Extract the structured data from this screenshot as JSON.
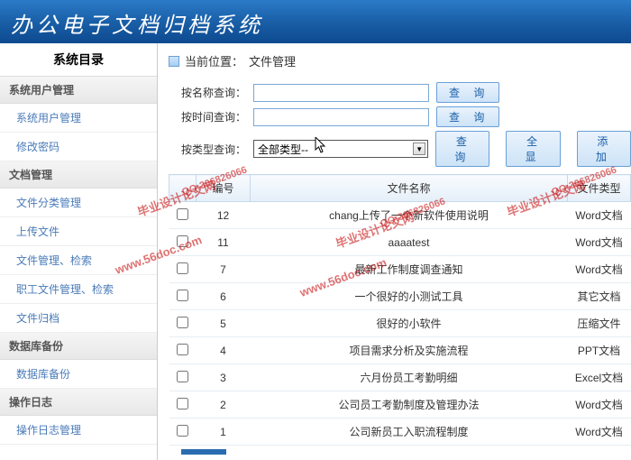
{
  "header": {
    "title": "办公电子文档归档系统"
  },
  "sidebar": {
    "title": "系统目录",
    "groups": [
      {
        "label": "系统用户管理",
        "items": [
          "系统用户管理",
          "修改密码"
        ]
      },
      {
        "label": "文档管理",
        "items": [
          "文件分类管理",
          "上传文件",
          "文件管理、检索",
          "职工文件管理、检索",
          "文件归档"
        ]
      },
      {
        "label": "数据库备份",
        "items": [
          "数据库备份"
        ]
      },
      {
        "label": "操作日志",
        "items": [
          "操作日志管理"
        ]
      }
    ]
  },
  "breadcrumb": {
    "prefix": "当前位置：",
    "current": "文件管理"
  },
  "search": {
    "byName": {
      "label": "按名称查询：",
      "btn": "查 询"
    },
    "byTime": {
      "label": "按时间查询：",
      "btn": "查 询"
    },
    "byType": {
      "label": "按类型查询：",
      "selected": "全部类型--",
      "btn": "查 询",
      "showAll": "全 显",
      "add": "添 加"
    }
  },
  "table": {
    "headers": [
      "",
      "编号",
      "文件名称",
      "文件类型"
    ],
    "rows": [
      {
        "id": "12",
        "name": "chang上传了一个新软件使用说明",
        "type": "Word文档"
      },
      {
        "id": "11",
        "name": "aaaatest",
        "type": "Word文档"
      },
      {
        "id": "7",
        "name": "最新工作制度调查通知",
        "type": "Word文档"
      },
      {
        "id": "6",
        "name": "一个很好的小测试工具",
        "type": "其它文档"
      },
      {
        "id": "5",
        "name": "很好的小软件",
        "type": "压缩文件"
      },
      {
        "id": "4",
        "name": "项目需求分析及实施流程",
        "type": "PPT文档"
      },
      {
        "id": "3",
        "name": "六月份员工考勤明细",
        "type": "Excel文档"
      },
      {
        "id": "2",
        "name": "公司员工考勤制度及管理办法",
        "type": "Word文档"
      },
      {
        "id": "1",
        "name": "公司新员工入职流程制度",
        "type": "Word文档"
      }
    ]
  },
  "watermark": {
    "text1": "毕业设计论文网",
    "text2": "www.56doc.com",
    "qq": "QQ:306826066"
  }
}
